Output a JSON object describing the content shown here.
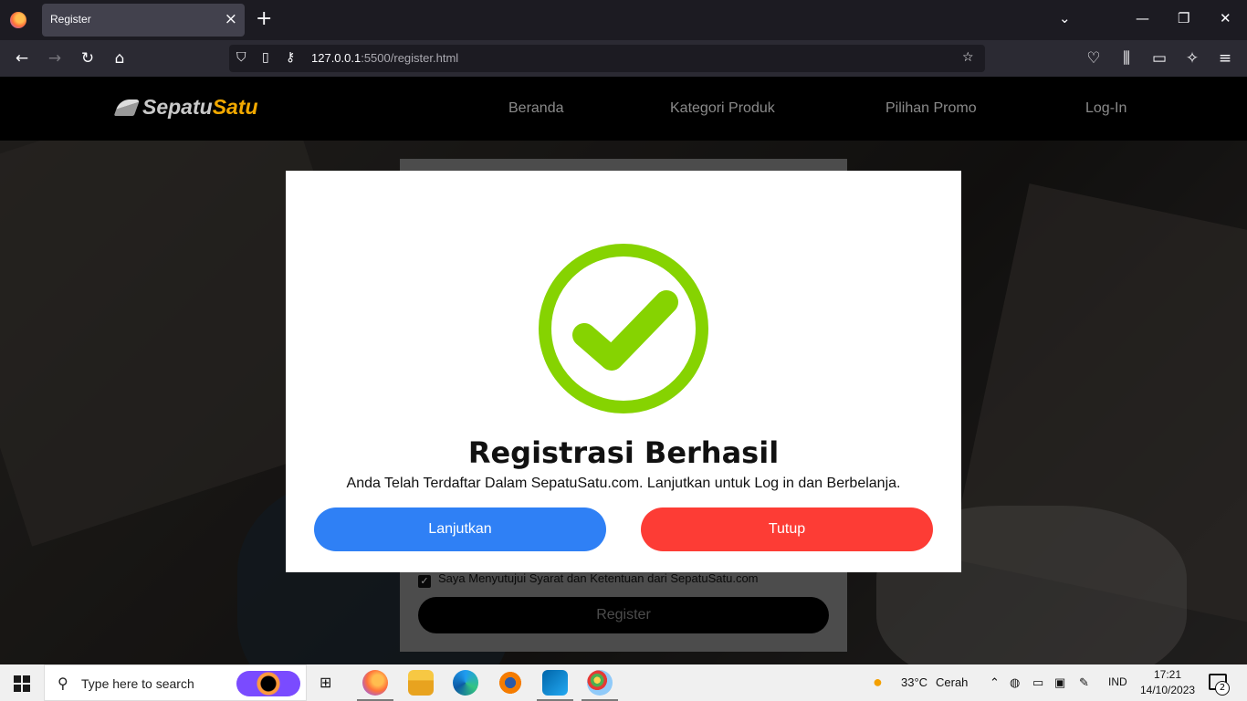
{
  "browser": {
    "tab_title": "Register",
    "url_host": "127.0.0.1",
    "url_path": ":5500/register.html"
  },
  "site": {
    "logo_part1": "Sepatu",
    "logo_part2": "Satu",
    "menu": [
      "Beranda",
      "Kategori Produk",
      "Pilihan Promo",
      "Log-In"
    ]
  },
  "form": {
    "agree_label": "Saya Menyutujui Syarat dan Ketentuan dari SepatuSatu.com",
    "register_label": "Register"
  },
  "modal": {
    "title": "Registrasi Berhasil",
    "message": "Anda Telah Terdaftar Dalam SepatuSatu.com. Lanjutkan untuk Log in dan Berbelanja.",
    "continue_label": "Lanjutkan",
    "close_label": "Tutup"
  },
  "taskbar": {
    "search_placeholder": "Type here to search",
    "weather_temp": "33°C",
    "weather_desc": "Cerah",
    "lang": "IND",
    "time": "17:21",
    "date": "14/10/2023",
    "notifications": "2"
  },
  "colors": {
    "check_green": "#86d301",
    "continue_blue": "#2f80f5",
    "close_red": "#fd3c35",
    "logo_gold": "#f2a900"
  }
}
